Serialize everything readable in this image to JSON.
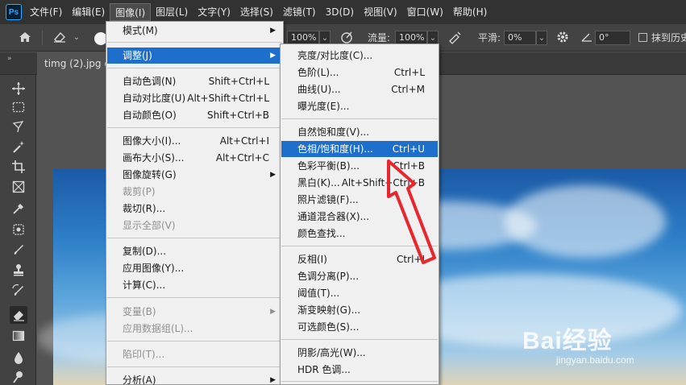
{
  "app": {
    "logo_text": "Ps"
  },
  "menubar": {
    "items": [
      "文件(F)",
      "编辑(E)",
      "图像(I)",
      "图层(L)",
      "文字(Y)",
      "选择(S)",
      "滤镜(T)",
      "3D(D)",
      "视图(V)",
      "窗口(W)",
      "帮助(H)"
    ],
    "active_index": 2
  },
  "options": {
    "opacity_value": "100%",
    "flow_label": "流量:",
    "flow_value": "100%",
    "smooth_label": "平滑:",
    "smooth_value": "0%",
    "angle_value": "0°",
    "erase_history_label": "抹到历史"
  },
  "tabs": {
    "collapse": "»",
    "document": "timg (2).jpg @"
  },
  "image_menu": {
    "items": [
      {
        "label": "模式(M)",
        "shortcut": "",
        "submenu": true,
        "disabled": false,
        "highlighted": false
      },
      {
        "label": "调整(J)",
        "shortcut": "",
        "submenu": true,
        "disabled": false,
        "highlighted": true
      },
      {
        "label": "自动色调(N)",
        "shortcut": "Shift+Ctrl+L",
        "submenu": false,
        "disabled": false,
        "highlighted": false
      },
      {
        "label": "自动对比度(U)",
        "shortcut": "Alt+Shift+Ctrl+L",
        "submenu": false,
        "disabled": false,
        "highlighted": false
      },
      {
        "label": "自动颜色(O)",
        "shortcut": "Shift+Ctrl+B",
        "submenu": false,
        "disabled": false,
        "highlighted": false
      },
      {
        "label": "图像大小(I)...",
        "shortcut": "Alt+Ctrl+I",
        "submenu": false,
        "disabled": false,
        "highlighted": false
      },
      {
        "label": "画布大小(S)...",
        "shortcut": "Alt+Ctrl+C",
        "submenu": false,
        "disabled": false,
        "highlighted": false
      },
      {
        "label": "图像旋转(G)",
        "shortcut": "",
        "submenu": true,
        "disabled": false,
        "highlighted": false
      },
      {
        "label": "裁剪(P)",
        "shortcut": "",
        "submenu": false,
        "disabled": true,
        "highlighted": false
      },
      {
        "label": "裁切(R)...",
        "shortcut": "",
        "submenu": false,
        "disabled": false,
        "highlighted": false
      },
      {
        "label": "显示全部(V)",
        "shortcut": "",
        "submenu": false,
        "disabled": true,
        "highlighted": false
      },
      {
        "label": "复制(D)...",
        "shortcut": "",
        "submenu": false,
        "disabled": false,
        "highlighted": false
      },
      {
        "label": "应用图像(Y)...",
        "shortcut": "",
        "submenu": false,
        "disabled": false,
        "highlighted": false
      },
      {
        "label": "计算(C)...",
        "shortcut": "",
        "submenu": false,
        "disabled": false,
        "highlighted": false
      },
      {
        "label": "变量(B)",
        "shortcut": "",
        "submenu": true,
        "disabled": true,
        "highlighted": false
      },
      {
        "label": "应用数据组(L)...",
        "shortcut": "",
        "submenu": false,
        "disabled": true,
        "highlighted": false
      },
      {
        "label": "陷印(T)...",
        "shortcut": "",
        "submenu": false,
        "disabled": true,
        "highlighted": false
      },
      {
        "label": "分析(A)",
        "shortcut": "",
        "submenu": true,
        "disabled": false,
        "highlighted": false
      }
    ]
  },
  "adjustments_menu": {
    "items": [
      {
        "label": "亮度/对比度(C)...",
        "shortcut": "",
        "highlighted": false
      },
      {
        "label": "色阶(L)...",
        "shortcut": "Ctrl+L",
        "highlighted": false
      },
      {
        "label": "曲线(U)...",
        "shortcut": "Ctrl+M",
        "highlighted": false
      },
      {
        "label": "曝光度(E)...",
        "shortcut": "",
        "highlighted": false
      },
      {
        "label": "自然饱和度(V)...",
        "shortcut": "",
        "highlighted": false
      },
      {
        "label": "色相/饱和度(H)...",
        "shortcut": "Ctrl+U",
        "highlighted": true
      },
      {
        "label": "色彩平衡(B)...",
        "shortcut": "Ctrl+B",
        "highlighted": false
      },
      {
        "label": "黑白(K)...",
        "shortcut": "Alt+Shift+Ctrl+B",
        "highlighted": false
      },
      {
        "label": "照片滤镜(F)...",
        "shortcut": "",
        "highlighted": false
      },
      {
        "label": "通道混合器(X)...",
        "shortcut": "",
        "highlighted": false
      },
      {
        "label": "颜色查找...",
        "shortcut": "",
        "highlighted": false
      },
      {
        "label": "反相(I)",
        "shortcut": "Ctrl+I",
        "highlighted": false
      },
      {
        "label": "色调分离(P)...",
        "shortcut": "",
        "highlighted": false
      },
      {
        "label": "阈值(T)...",
        "shortcut": "",
        "highlighted": false
      },
      {
        "label": "渐变映射(G)...",
        "shortcut": "",
        "highlighted": false
      },
      {
        "label": "可选颜色(S)...",
        "shortcut": "",
        "highlighted": false
      },
      {
        "label": "阴影/高光(W)...",
        "shortcut": "",
        "highlighted": false
      },
      {
        "label": "HDR 色调...",
        "shortcut": "",
        "highlighted": false
      }
    ]
  },
  "watermark": {
    "brand": "Bai经验",
    "url": "jingyan.baidu.com"
  },
  "colors": {
    "highlight": "#1e6fcc",
    "annotation_arrow": "#e8262d"
  }
}
